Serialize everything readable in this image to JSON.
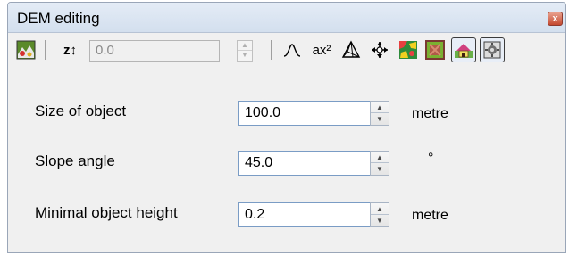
{
  "window": {
    "title": "DEM editing",
    "close_symbol": "x"
  },
  "toolbar": {
    "z_label": "z↕",
    "height_value": "0.0",
    "ax2_label": "ax²",
    "icons": [
      "dem-landscape-icon",
      "z-icon",
      "spin-icon",
      "curve-icon",
      "ax2-icon",
      "pyramid-icon",
      "move-icon",
      "dem-color-icon",
      "dem-pattern-icon",
      "building-icon",
      "settings-icon"
    ]
  },
  "fields": [
    {
      "label": "Size of object",
      "value": "100.0",
      "unit": "metre"
    },
    {
      "label": "Slope angle",
      "value": "45.0",
      "unit": "°"
    },
    {
      "label": "Minimal object height",
      "value": "0.2",
      "unit": "metre"
    }
  ]
}
